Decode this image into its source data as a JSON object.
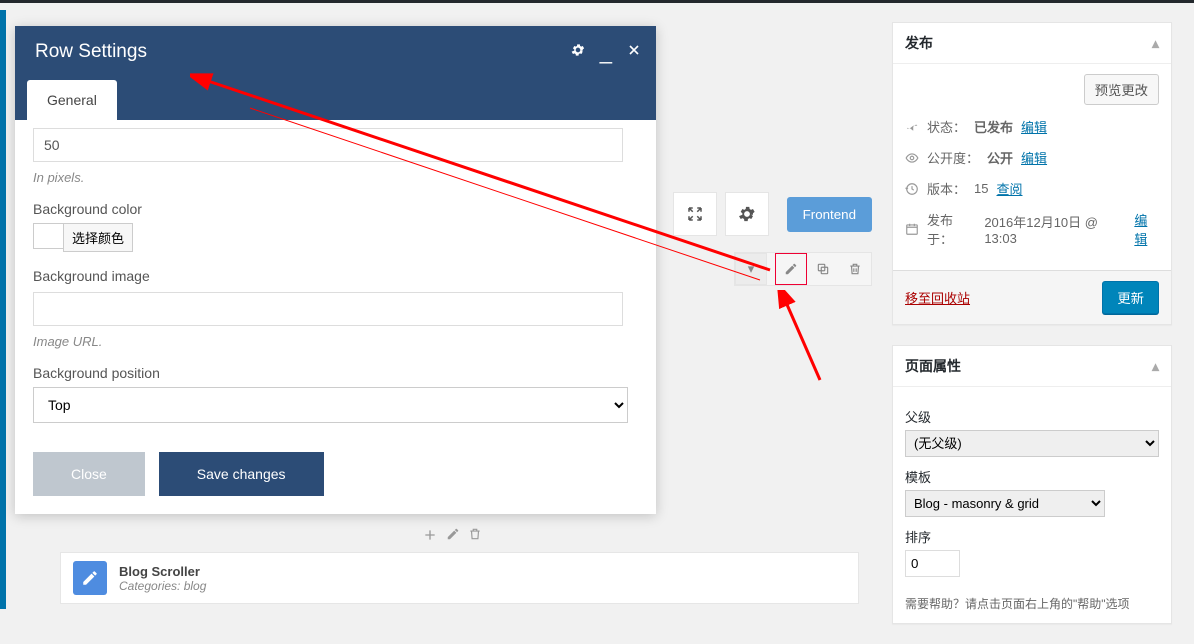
{
  "modal": {
    "title": "Row Settings",
    "tab_general": "General",
    "value_50": "50",
    "hint_pixels": "In pixels.",
    "label_bgcolor": "Background color",
    "btn_choose_color": "选择颜色",
    "label_bgimage": "Background image",
    "hint_imageurl": "Image URL.",
    "label_bgposition": "Background position",
    "bgposition_value": "Top",
    "btn_close": "Close",
    "btn_save": "Save changes"
  },
  "toolbar": {
    "frontend": "Frontend"
  },
  "publish": {
    "title": "发布",
    "preview_btn": "预览更改",
    "status_label": "状态：",
    "status_value": "已发布",
    "visibility_label": "公开度：",
    "visibility_value": "公开",
    "revisions_label": "版本：",
    "revisions_value": "15",
    "browse_link": "查阅",
    "edit_link": "编辑",
    "published_label": "发布于：",
    "published_value": "2016年12月10日 @ 13:03",
    "trash_link": "移至回收站",
    "update_btn": "更新"
  },
  "page_attr": {
    "title": "页面属性",
    "parent_label": "父级",
    "parent_value": "(无父级)",
    "template_label": "模板",
    "template_value": "Blog - masonry & grid",
    "order_label": "排序",
    "order_value": "0",
    "help_text": "需要帮助？请点击页面右上角的\"帮助\"选项"
  },
  "card": {
    "title": "Blog Scroller",
    "subtitle": "Categories: blog"
  }
}
